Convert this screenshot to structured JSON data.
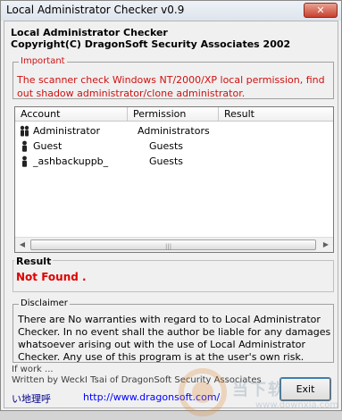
{
  "window": {
    "title": "Local Administrator Checker v0.9",
    "close_glyph": "✕"
  },
  "header": {
    "line1": "Local Administrator Checker",
    "line2": "Copyright(C) DragonSoft Security Associates 2002"
  },
  "important": {
    "label": "Important",
    "text": "The scanner check Windows NT/2000/XP local permission, find out shadow administrator/clone administrator."
  },
  "table": {
    "columns": [
      "Account",
      "Permission",
      "Result"
    ],
    "rows": [
      {
        "account": "Administrator",
        "permission": "Administrators",
        "result": ""
      },
      {
        "account": "Guest",
        "permission": "Guests",
        "result": ""
      },
      {
        "account": "_ashbackuppb_",
        "permission": "Guests",
        "result": ""
      }
    ],
    "row_icon": "users-icon",
    "scroll_left_glyph": "◀",
    "scroll_right_glyph": "▶",
    "thumb_grip": "|||"
  },
  "result": {
    "label": "Result",
    "value": "Not Found ."
  },
  "disclaimer": {
    "label": "Disclaimer",
    "text": "There are No warranties with regard to to Local Administrator Checker. In no event shall the author be liable for any damages whatsoever arising out with the use of Local Administrator Checker. Any use of this program is at the user's own risk."
  },
  "footer": {
    "if_work": "If work ...",
    "written_by": "Written by WeckI Tsai of DragonSoft Security Associates",
    "prefix_link": "い地理呼",
    "url": "http://www.dragonsoft.com/"
  },
  "exit_button": {
    "label": "Exit"
  },
  "watermark": {
    "text": "当下软件园",
    "url": "www.downxia.com"
  },
  "colors": {
    "important_text": "#d01010",
    "result_value": "#e00000",
    "link": "#0000ff",
    "prefix_link": "#00008b"
  }
}
